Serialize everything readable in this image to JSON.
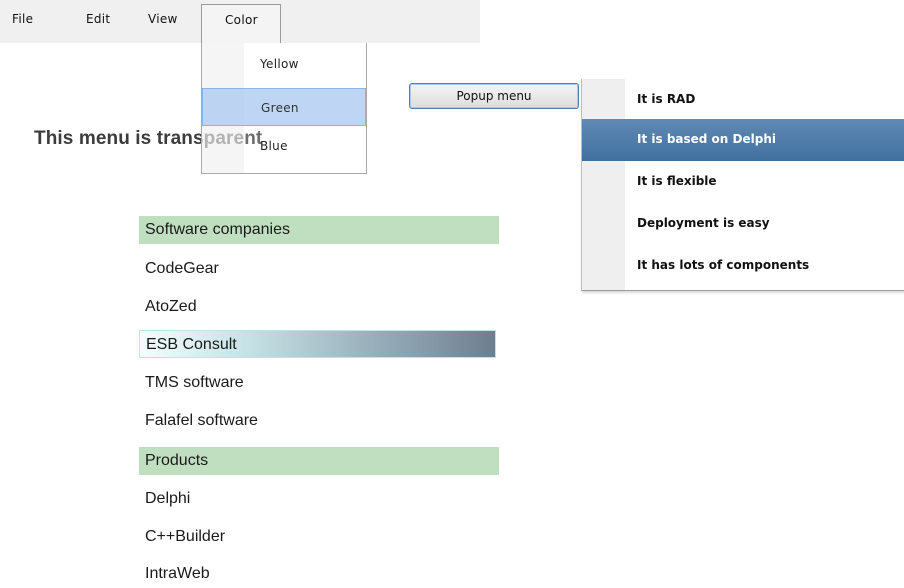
{
  "menubar": {
    "items": [
      {
        "label": "File"
      },
      {
        "label": "Edit"
      },
      {
        "label": "View"
      },
      {
        "label": "Color"
      }
    ]
  },
  "color_menu": {
    "items": [
      {
        "label": "Yellow"
      },
      {
        "label": "Green",
        "selected": true
      },
      {
        "label": "Blue"
      }
    ]
  },
  "heading": "This menu is transparent",
  "popup_button": {
    "label": "Popup menu"
  },
  "popup_menu": {
    "items": [
      {
        "label": "It is RAD"
      },
      {
        "label": "It is based on Delphi",
        "selected": true
      },
      {
        "label": "It is flexible"
      },
      {
        "label": "Deployment is easy"
      },
      {
        "label": "It has lots of components"
      }
    ]
  },
  "list": {
    "items": [
      {
        "label": "Software companies",
        "kind": "header"
      },
      {
        "label": "CodeGear"
      },
      {
        "label": "AtoZed"
      },
      {
        "label": "ESB Consult",
        "selected": true
      },
      {
        "label": "TMS software"
      },
      {
        "label": "Falafel software"
      },
      {
        "label": "Products",
        "kind": "header"
      },
      {
        "label": "Delphi"
      },
      {
        "label": "C++Builder"
      },
      {
        "label": "IntraWeb"
      }
    ]
  },
  "colors": {
    "group_header_bg": "#c0dfc0",
    "popup_selected_bg": "#4f7ca8",
    "dropdown_selected_bg": "#b8d4f5"
  }
}
